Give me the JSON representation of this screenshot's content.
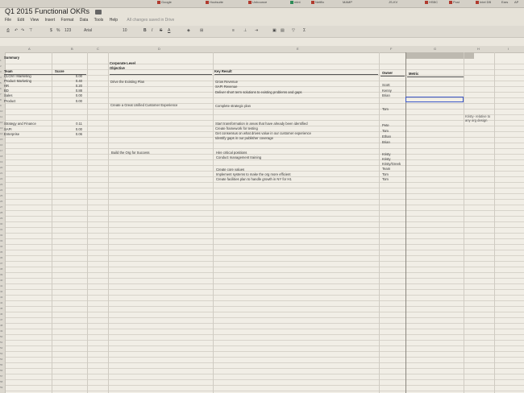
{
  "bookmarks": [
    "Google",
    "Hootsuite",
    "Unbounce",
    "mint",
    "Netflix",
    "MAMP",
    "JS-KV",
    "HSBC",
    "Post",
    "Intel DB",
    "Ears",
    "AP"
  ],
  "doc_title": "Q1 2015 Functional OKRs",
  "menu": {
    "items": [
      "File",
      "Edit",
      "View",
      "Insert",
      "Format",
      "Data",
      "Tools",
      "Help"
    ],
    "saved_status": "All changes saved in Drive"
  },
  "toolbar": {
    "zoom": "123",
    "font": "Arial",
    "font_size": "10",
    "bold": "B",
    "italic": "I",
    "strike": "S",
    "text_color": "A",
    "sigma": "Σ"
  },
  "columns": [
    "A",
    "B",
    "C",
    "D",
    "E",
    "F",
    "G",
    "H",
    "I"
  ],
  "row_numbers": [
    "1",
    "2",
    "3",
    "4",
    "5",
    "6",
    "7",
    "8",
    "9",
    "10",
    "11",
    "12",
    "13",
    "14",
    "15",
    "16",
    "17",
    "18",
    "19",
    "20",
    "21",
    "22",
    "23",
    "24",
    "25",
    "26",
    "27",
    "28",
    "29",
    "30",
    "31",
    "32",
    "33",
    "34",
    "35",
    "36",
    "37",
    "38",
    "39",
    "40",
    "41",
    "42",
    "43",
    "44",
    "45",
    "46",
    "47",
    "48",
    "49",
    "50",
    "51",
    "52",
    "53",
    "54",
    "55",
    "56",
    "57",
    "58",
    "59"
  ],
  "summary": {
    "title": "Summary",
    "team_header": "Team",
    "score_header": "Score",
    "rows": [
      {
        "team": "CLCM / Marketing",
        "score": "0.00"
      },
      {
        "team": "Product Marketing",
        "score": "0.40"
      },
      {
        "team": "HR",
        "score": "0.20"
      },
      {
        "team": "BD",
        "score": "0.88"
      },
      {
        "team": "Sales",
        "score": "0.00"
      },
      {
        "team": "Product",
        "score": "0.00"
      }
    ],
    "rows2": [
      {
        "team": "Strategy and Finance",
        "score": "0.11"
      },
      {
        "team": "SAPI",
        "score": "0.00"
      },
      {
        "team": "Enterprise",
        "score": "0.06"
      }
    ]
  },
  "objectives": {
    "header_line1": "Corporate Level",
    "header_line2": "Objective",
    "items": [
      "Drive the Existing Plan",
      "Create a Great Unified Customer Experience",
      "Build the Org for Success"
    ]
  },
  "key_results": {
    "header": "Key Result",
    "group1": [
      "Grow Revenue",
      "SAPI Revenue",
      "Deliver short term solutions to existing problems and gaps"
    ],
    "group2": [
      "Complete strategic plan"
    ],
    "group3": [
      "Start transformation in areas that have already been identified",
      "Create framework for testing",
      "Get consensus on what drives value in our customer experience",
      "Identify gaps in our publisher coverage"
    ],
    "group4": [
      "Hire critical positions",
      "Conduct management training"
    ],
    "group5": [
      "Create core values",
      "Implement systems to make the org more efficient",
      "Create facilities plan to handle growth in NY for H1"
    ]
  },
  "owner": {
    "header": "Owner",
    "group1": [
      "Scott",
      "Kenny",
      "Brian"
    ],
    "group2": [
      "Tom"
    ],
    "group3": [
      "Pete",
      "Tom",
      "Ethan",
      "Brian"
    ],
    "group4": [
      "Kristy",
      "Kristy",
      "Kristy/Greek",
      "Team",
      "Tom",
      "Tom"
    ]
  },
  "metric": {
    "header": "Metric"
  },
  "note": "Kristy- relative to any org design"
}
